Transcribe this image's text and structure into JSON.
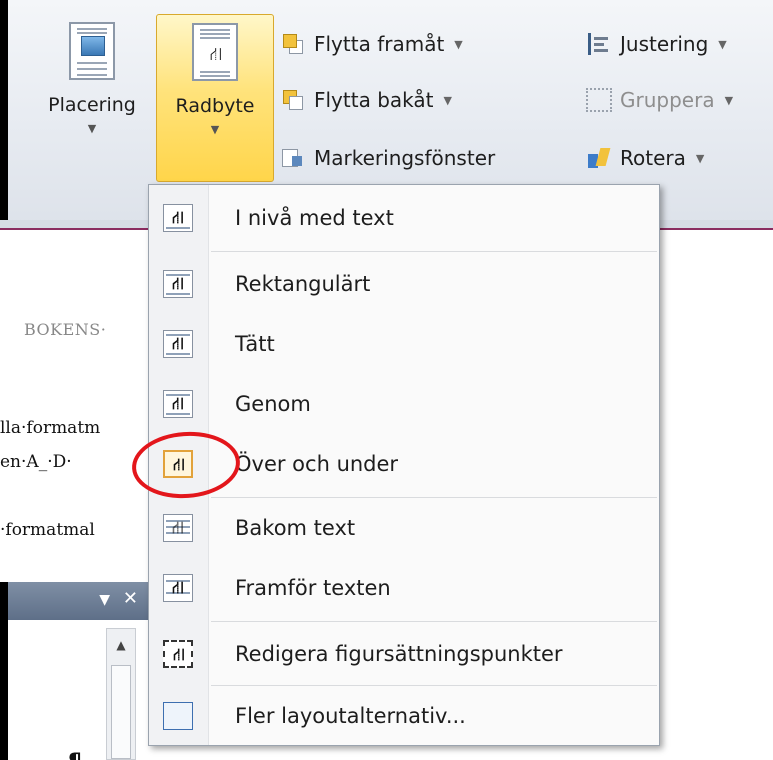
{
  "ribbon": {
    "placering_label": "Placering",
    "radbyte_label": "Radbyte",
    "flytta_framat": "Flytta framåt",
    "flytta_bakat": "Flytta bakåt",
    "markeringsfonster": "Markeringsfönster",
    "justering": "Justering",
    "gruppera": "Gruppera",
    "rotera": "Rotera",
    "dropdown_glyph": "▼"
  },
  "document": {
    "header_text": "BOKENS·",
    "line1": "lla·formatm",
    "line2": "en·A_·D·",
    "line3": "·formatmal"
  },
  "pane": {
    "dropdown_glyph": "▼",
    "close_glyph": "✕",
    "scroll_up_glyph": "▲",
    "pilcrow": "¶"
  },
  "menu": {
    "items": [
      {
        "label": "I nivå med text",
        "icon": "inline-text-icon"
      },
      {
        "label": "Rektangulärt",
        "icon": "square-wrap-icon"
      },
      {
        "label": "Tätt",
        "icon": "tight-wrap-icon"
      },
      {
        "label": "Genom",
        "icon": "through-wrap-icon"
      },
      {
        "label": "Över och under",
        "icon": "top-bottom-wrap-icon"
      },
      {
        "label": "Bakom text",
        "icon": "behind-text-icon"
      },
      {
        "label": "Framför texten",
        "icon": "in-front-text-icon"
      },
      {
        "label": "Redigera figursättningspunkter",
        "icon": "edit-wrap-points-icon"
      },
      {
        "label": "Fler layoutalternativ...",
        "icon": "more-layout-icon"
      }
    ]
  },
  "colors": {
    "radbyte_active": "#ffd54a",
    "annotation_circle": "#e3161b",
    "ribbon_accent": "#8a2b5f"
  }
}
